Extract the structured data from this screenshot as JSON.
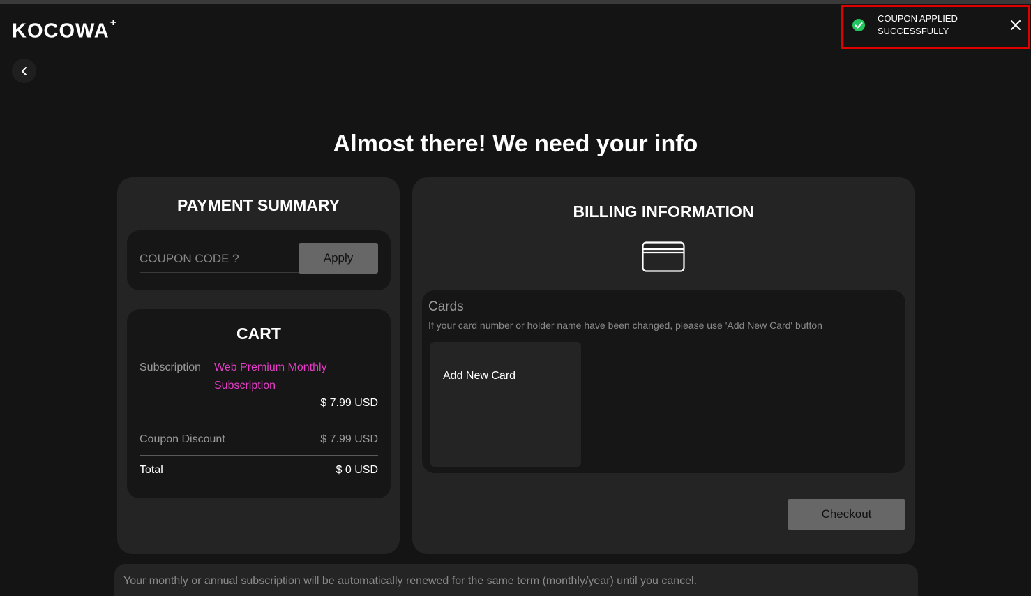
{
  "header": {
    "logo_text": "KOCOWA",
    "logo_plus": "+"
  },
  "toast": {
    "message_line1": "COUPON APPLIED",
    "message_line2": "SUCCESSFULLY",
    "status_color": "#22c55e",
    "highlight_color": "#e00000",
    "icons": {
      "status": "check-circle-icon",
      "close": "close-icon"
    }
  },
  "page": {
    "title": "Almost there! We need your info"
  },
  "payment_summary": {
    "heading": "PAYMENT SUMMARY",
    "coupon": {
      "placeholder": "COUPON CODE ?",
      "value": "",
      "apply_label": "Apply"
    },
    "cart": {
      "title": "CART",
      "subscription_label": "Subscription",
      "subscription_name": "Web Premium Monthly Subscription",
      "subscription_price": "$ 7.99 USD",
      "discount_label": "Coupon Discount",
      "discount_value": "$ 7.99 USD",
      "total_label": "Total",
      "total_value": "$ 0 USD",
      "accent_color": "#e63cc8"
    }
  },
  "billing": {
    "heading": "BILLING INFORMATION",
    "icon": "credit-card-icon",
    "cards_title": "Cards",
    "cards_help": "If your card number or holder name have been changed, please use 'Add New Card' button",
    "add_card_label": "Add New Card",
    "checkout_label": "Checkout"
  },
  "footer_notice": {
    "text": "Your monthly or annual subscription will be automatically renewed for the same term (monthly/year) until you cancel."
  }
}
